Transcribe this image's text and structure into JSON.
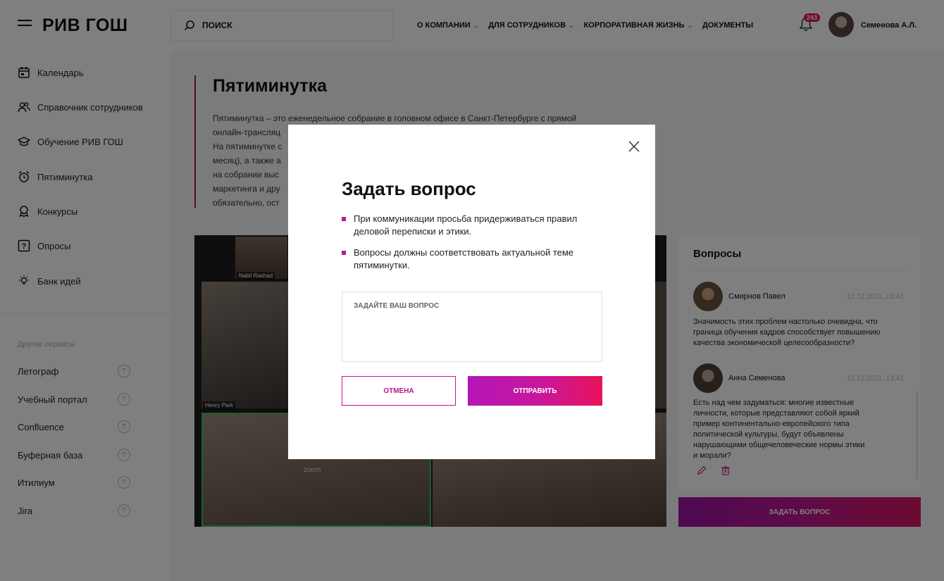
{
  "header": {
    "logo": "РИВ ГОШ",
    "search_placeholder": "ПОИСК",
    "nav": [
      "О КОМПАНИИ",
      "ДЛЯ СОТРУДНИКОВ",
      "КОРПОРАТИВНАЯ ЖИЗНЬ",
      "ДОКУМЕНТЫ"
    ],
    "notifications_count": "243",
    "user_name": "Семенова А.Л."
  },
  "sidebar": {
    "items": [
      {
        "label": "Календарь",
        "icon": "calendar-icon"
      },
      {
        "label": "Справочник сотрудников",
        "icon": "people-icon"
      },
      {
        "label": "Обучение РИВ ГОШ",
        "icon": "graduation-cap-icon"
      },
      {
        "label": "Пятиминутка",
        "icon": "alarm-clock-icon"
      },
      {
        "label": "Конкурсы",
        "icon": "award-icon"
      },
      {
        "label": "Опросы",
        "icon": "question-box-icon"
      },
      {
        "label": "Банк идей",
        "icon": "lightbulb-icon"
      }
    ],
    "other_title": "Другие сервисы",
    "services": [
      "Летограф",
      "Учебный портал",
      "Confluence",
      "Буферная база",
      "Итилиум",
      "Jira"
    ]
  },
  "main": {
    "title": "Пятиминутка",
    "description_lines": [
      "Пятиминутка – это еженедельное собрание в головном офисе в Санкт-Петербурге с прямой",
      "онлайн-трансляц",
      "На пятиминутке с",
      "месяц), а также а",
      "на собрании выс",
      "маркетинга и дру",
      "обязательно, ост"
    ],
    "video": {
      "labels": [
        "Nabil Rashad",
        "Henry Park"
      ],
      "zoom_tag": "zoom"
    }
  },
  "questions": {
    "title": "Вопросы",
    "items": [
      {
        "author": "Смирнов Павел",
        "date": "12.12.2021, 13:42",
        "text": [
          "Значимость этих проблем настолько очевидна, что",
          "граница обучения кадров способствует повышению",
          "качества экономической целесообразности?"
        ]
      },
      {
        "author": "Анна Семенова",
        "date": "12.12.2021, 13:42",
        "text": [
          "Есть над чем задуматься: многие известные",
          "личности, которые представляют собой яркий",
          "пример континентально-европейского типа",
          "политической культуры, будут объявлены",
          "нарушающими общечеловеческие нормы этики",
          "и морали?"
        ]
      }
    ],
    "ask_button": "ЗАДАТЬ ВОПРОС"
  },
  "modal": {
    "title": "Задать вопрос",
    "rules": [
      [
        "При коммуникации просьба придерживаться правил",
        "деловой переписки и этики."
      ],
      [
        "Вопросы должны соответствовать актуальной теме",
        "пятиминутки."
      ]
    ],
    "placeholder": "ЗАДАЙТЕ ВАШ ВОПРОС",
    "cancel": "ОТМЕНА",
    "submit": "ОТПРАВИТЬ"
  },
  "colors": {
    "accent": "#c0168f",
    "accent_end": "#e8125a",
    "badge": "#e8194c"
  }
}
